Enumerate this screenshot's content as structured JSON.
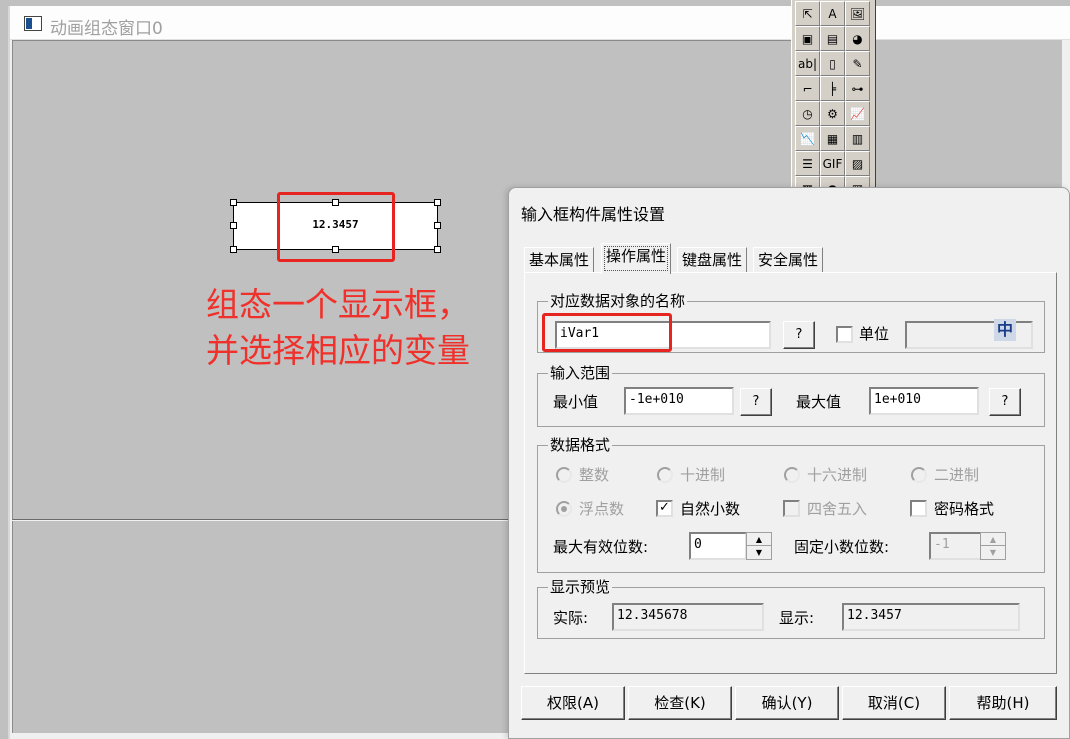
{
  "mdi_window": {
    "title": "动画组态窗口0"
  },
  "canvas": {
    "display_box_value": "12.3457",
    "annotation_line1": "组态一个显示框，",
    "annotation_line2": "并选择相应的变量"
  },
  "toolbox": {
    "tools": [
      {
        "name": "pointer-tool-icon",
        "glyph": "⇱"
      },
      {
        "name": "text-tool-icon",
        "glyph": "A"
      },
      {
        "name": "bitmap-tool-icon",
        "glyph": "🖼"
      },
      {
        "name": "standard-button-tool-icon",
        "glyph": "▣"
      },
      {
        "name": "motion-button-tool-icon",
        "glyph": "▤"
      },
      {
        "name": "graph-tool-icon",
        "glyph": "◕"
      },
      {
        "name": "input-box-tool-icon",
        "glyph": "ab|"
      },
      {
        "name": "slider-tool-icon",
        "glyph": "▯"
      },
      {
        "name": "flow-tool-icon",
        "glyph": "✎"
      },
      {
        "name": "line-tool-icon",
        "glyph": "⌐"
      },
      {
        "name": "step-line-tool-icon",
        "glyph": "╞"
      },
      {
        "name": "valve-tool-icon",
        "glyph": "⊶"
      },
      {
        "name": "meter-tool-icon",
        "glyph": "◷"
      },
      {
        "name": "rotary-tool-icon",
        "glyph": "⚙"
      },
      {
        "name": "trend-tool-icon",
        "glyph": "📈"
      },
      {
        "name": "history-curve-tool-icon",
        "glyph": "📉"
      },
      {
        "name": "table-tool-icon",
        "glyph": "▦"
      },
      {
        "name": "report-tool-icon",
        "glyph": "▥"
      },
      {
        "name": "list-tool-icon",
        "glyph": "☰"
      },
      {
        "name": "gif-tool-icon",
        "glyph": "GIF"
      },
      {
        "name": "curve-tool-icon",
        "glyph": "▨"
      },
      {
        "name": "qr-tool-icon",
        "glyph": "▩"
      },
      {
        "name": "lamp-tool-icon",
        "glyph": "●"
      },
      {
        "name": "alarm-tool-icon",
        "glyph": "▧"
      }
    ]
  },
  "dialog": {
    "title": "输入框构件属性设置",
    "tabs": [
      "基本属性",
      "操作属性",
      "键盘属性",
      "安全属性"
    ],
    "active_tab": "操作属性",
    "group_object": {
      "label": "对应数据对象的名称",
      "variable_value": "iVar1",
      "browse_button": "?",
      "unit_label": "单位",
      "unit_value": "",
      "ime_label": "中"
    },
    "group_range": {
      "label": "输入范围",
      "min_label": "最小值",
      "min_value": "-1e+010",
      "min_button": "?",
      "max_label": "最大值",
      "max_value": "1e+010",
      "max_button": "?"
    },
    "group_format": {
      "label": "数据格式",
      "radio_integer": "整数",
      "radio_decimal": "十进制",
      "radio_hex": "十六进制",
      "radio_binary": "二进制",
      "radio_float": "浮点数",
      "check_natural": "自然小数",
      "check_natural_mark": "✓",
      "check_round": "四舍五入",
      "check_password": "密码格式",
      "max_digits_label": "最大有效位数:",
      "max_digits_value": "0",
      "fixed_decimals_label": "固定小数位数:",
      "fixed_decimals_value": "-1",
      "spin_up": "▲",
      "spin_down": "▼"
    },
    "group_preview": {
      "label": "显示预览",
      "actual_label": "实际:",
      "actual_value": "12.345678",
      "display_label": "显示:",
      "display_value": "12.3457"
    },
    "buttons": {
      "permission": "权限(A)",
      "check": "检查(K)",
      "ok": "确认(Y)",
      "cancel": "取消(C)",
      "help": "帮助(H)"
    }
  }
}
